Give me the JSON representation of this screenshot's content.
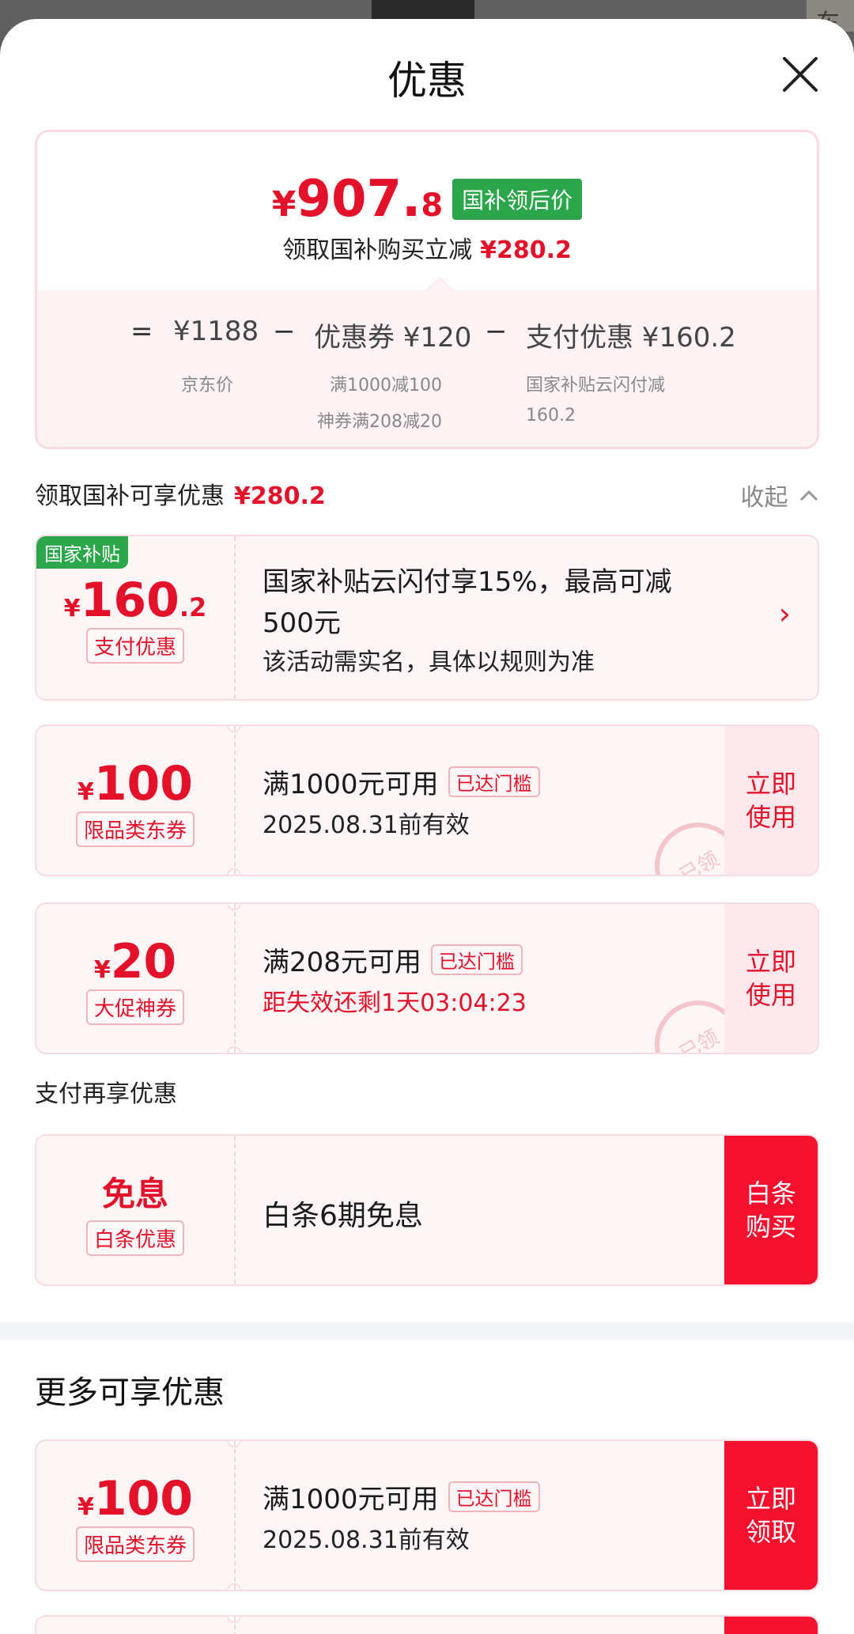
{
  "header": {
    "title": "优惠"
  },
  "summary": {
    "price_yen": "¥",
    "price_int": "907.",
    "price_dec": "8",
    "price_tag": "国补领后价",
    "save_label": "领取国补购买立减",
    "save_amount": "¥280.2",
    "formula": {
      "equals": "=",
      "minus": "−",
      "jd_price": "¥1188",
      "jd_price_label": "京东价",
      "coupon": "优惠券 ¥120",
      "coupon_note_1": "满1000减100",
      "coupon_note_2": "神券满208减20",
      "pay": "支付优惠 ¥160.2",
      "pay_note_1": "国家补贴云闪付减",
      "pay_note_2": "160.2"
    }
  },
  "gov_section": {
    "title": "领取国补可享优惠",
    "amount": "¥280.2",
    "collapse": "收起"
  },
  "cards": [
    {
      "tag": "国家补贴",
      "yen": "¥",
      "amount": "160",
      "decimal": ".2",
      "pill": "支付优惠",
      "main": "国家补贴云闪付享15%，最高可减",
      "main2": "500元",
      "sub": "该活动需实名，具体以规则为准"
    },
    {
      "yen": "¥",
      "amount": "100",
      "pill": "限品类东券",
      "main": "满1000元可用",
      "threshold": "已达门槛",
      "sub": "2025.08.31前有效",
      "action": "立即使用",
      "stamp": "已领"
    },
    {
      "yen": "¥",
      "amount": "20",
      "pill": "大促神券",
      "main": "满208元可用",
      "threshold": "已达门槛",
      "sub": "距失效还剩1天03:04:23",
      "action": "立即使用",
      "stamp": "已领"
    }
  ],
  "pay_section": {
    "title": "支付再享优惠"
  },
  "baitiao": {
    "amount": "免息",
    "pill": "白条优惠",
    "main": "白条6期免息",
    "action": "白条购买"
  },
  "more_section": {
    "title": "更多可享优惠"
  },
  "more_card": {
    "yen": "¥",
    "amount": "100",
    "pill": "限品类东券",
    "main": "满1000元可用",
    "threshold": "已达门槛",
    "sub": "2025.08.31前有效",
    "action": "立即领取"
  },
  "colors": {
    "accent": "#e3122a",
    "button": "#f5102d",
    "green_tag": "#2ba64a"
  },
  "icons": {
    "close": "close-icon",
    "collapse": "chevron-up-icon",
    "arrow": "chevron-right-icon"
  }
}
